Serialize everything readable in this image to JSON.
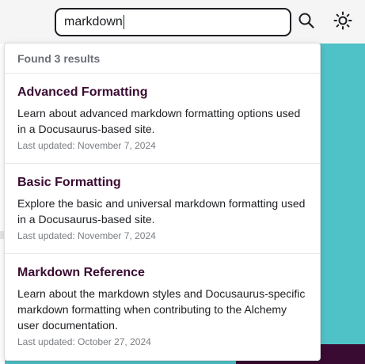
{
  "search": {
    "value": "markdown"
  },
  "results": {
    "count_label": "Found 3 results",
    "items": [
      {
        "title": "Advanced Formatting",
        "description": "Learn about advanced markdown formatting options used in a Docusaurus-based site.",
        "date": "Last updated: November 7, 2024"
      },
      {
        "title": "Basic Formatting",
        "description": "Explore the basic and universal markdown formatting used in a Docusaurus-based site.",
        "date": "Last updated: November 7, 2024"
      },
      {
        "title": "Markdown Reference",
        "description": "Learn about the markdown styles and Docusaurus-specific markdown formatting when contributing to the Alchemy user documentation.",
        "date": "Last updated: October 27, 2024"
      }
    ]
  },
  "icons": {
    "search": "search-icon",
    "theme": "sun-icon"
  },
  "colors": {
    "accent_teal": "#4fc2c7",
    "title_purple": "#3a0b32",
    "footer_purple": "#3a0b32"
  }
}
